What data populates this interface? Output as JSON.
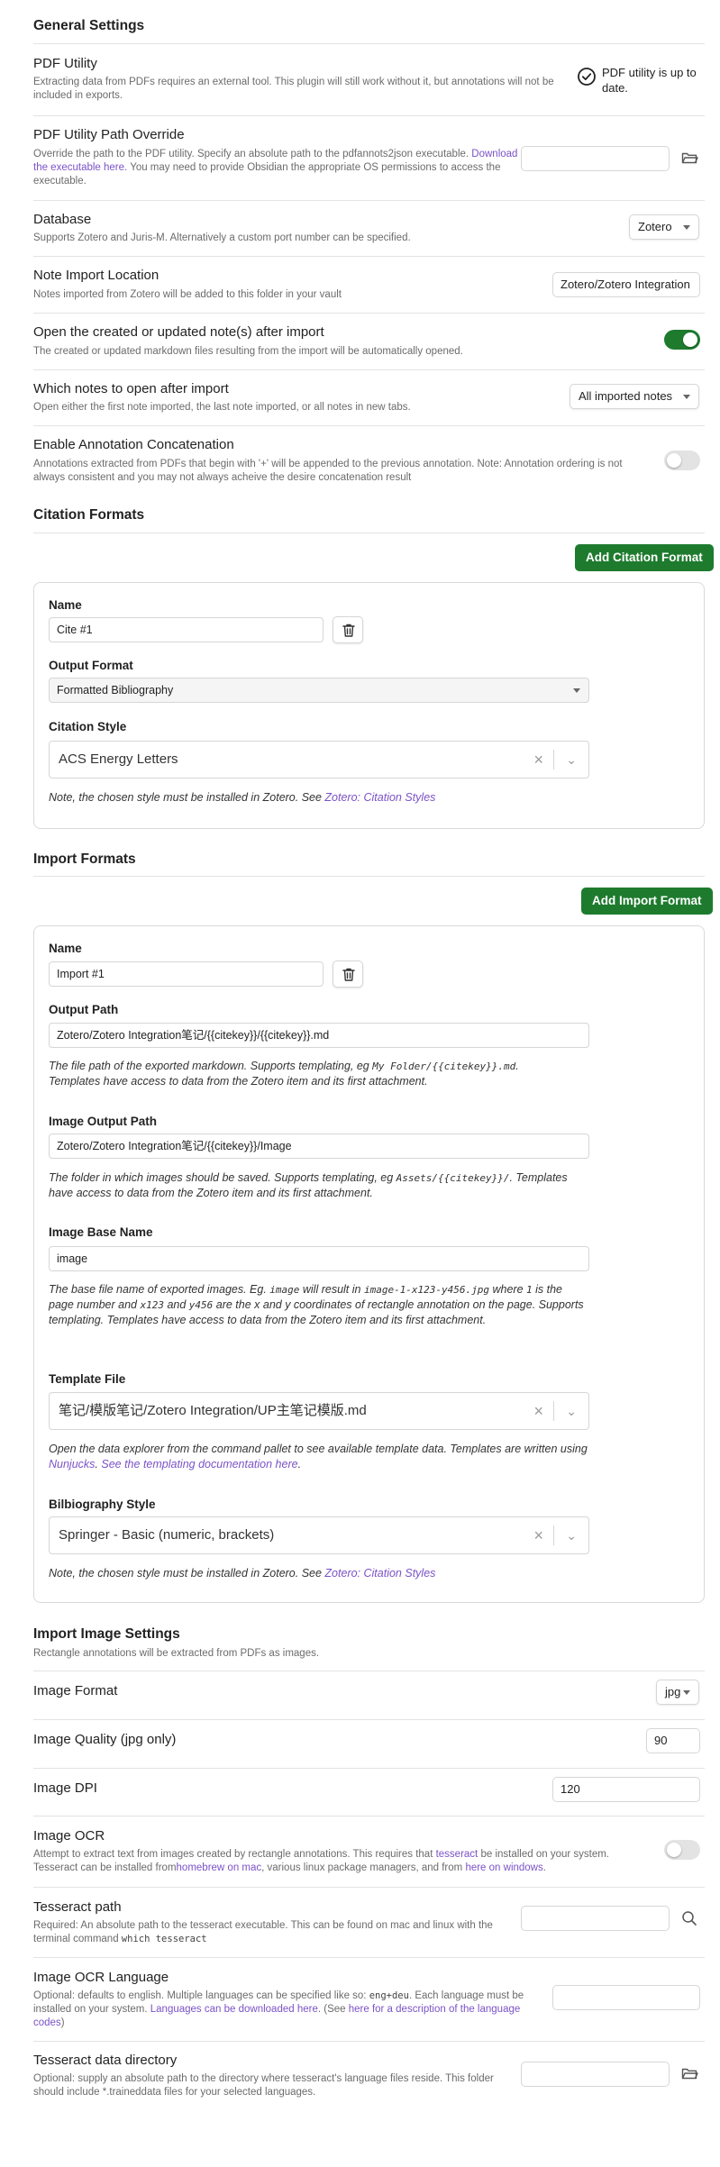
{
  "general": {
    "heading": "General Settings",
    "pdf_utility": {
      "name": "PDF Utility",
      "desc": "Extracting data from PDFs requires an external tool. This plugin will still work without it, but annotations will not be included in exports.",
      "status": "PDF utility is up to date."
    },
    "pdf_path": {
      "name": "PDF Utility Path Override",
      "desc_a": "Override the path to the PDF utility. Specify an absolute path to the pdfannots2json executable.",
      "desc_link": "Download the executable here.",
      "desc_b": " You may need to provide Obsidian the appropriate OS permissions to access the executable.",
      "value": ""
    },
    "database": {
      "name": "Database",
      "desc": "Supports Zotero and Juris-M. Alternatively a custom port number can be specified.",
      "value": "Zotero"
    },
    "note_location": {
      "name": "Note Import Location",
      "desc": "Notes imported from Zotero will be added to this folder in your vault",
      "value": "Zotero/Zotero Integration"
    },
    "open_after": {
      "name": "Open the created or updated note(s) after import",
      "desc": "The created or updated markdown files resulting from the import will be automatically opened.",
      "enabled": true
    },
    "which_notes": {
      "name": "Which notes to open after import",
      "desc": "Open either the first note imported, the last note imported, or all notes in new tabs.",
      "value": "All imported notes"
    },
    "concat": {
      "name": "Enable Annotation Concatenation",
      "desc": "Annotations extracted from PDFs that begin with '+' will be appended to the previous annotation. Note: Annotation ordering is not always consistent and you may not always acheive the desire concatenation result",
      "enabled": false
    }
  },
  "citation": {
    "heading": "Citation Formats",
    "add_label": "Add Citation Format",
    "name_label": "Name",
    "name_value": "Cite #1",
    "output_label": "Output Format",
    "output_value": "Formatted Bibliography",
    "style_label": "Citation Style",
    "style_value": "ACS Energy Letters",
    "note_a": "Note, the chosen style must be installed in Zotero. See ",
    "note_link": "Zotero: Citation Styles"
  },
  "import": {
    "heading": "Import Formats",
    "add_label": "Add Import Format",
    "name_label": "Name",
    "name_value": "Import #1",
    "output_path_label": "Output Path",
    "output_path_value": "Zotero/Zotero Integration笔记/{{citekey}}/{{citekey}}.md",
    "output_path_note_a": "The file path of the exported markdown. Supports templating, eg ",
    "output_path_note_code": "My Folder/{{citekey}}.md",
    "output_path_note_b": ". Templates have access to data from the Zotero item and its first attachment.",
    "image_output_label": "Image Output Path",
    "image_output_value": "Zotero/Zotero Integration笔记/{{citekey}}/Image",
    "image_output_note_a": "The folder in which images should be saved. Supports templating, eg ",
    "image_output_note_code": "Assets/{{citekey}}/",
    "image_output_note_b": ". Templates have access to data from the Zotero item and its first attachment.",
    "base_name_label": "Image Base Name",
    "base_name_value": "image",
    "base_name_note_1": "The base file name of exported images. Eg. ",
    "base_name_code_1": "image",
    "base_name_note_2": " will result in ",
    "base_name_code_2": "image-1-x123-y456.jpg",
    "base_name_note_3": " where ",
    "base_name_code_3": "1",
    "base_name_note_4": " is the page number and ",
    "base_name_code_4": "x123",
    "base_name_note_5": " and ",
    "base_name_code_5": "y456",
    "base_name_note_6": " are the x and y coordinates of rectangle annotation on the page. Supports templating. Templates have access to data from the Zotero item and its first attachment.",
    "template_label": "Template File",
    "template_value": "笔记/模版笔记/Zotero Integration/UP主笔记模版.md",
    "template_note_a": "Open the data explorer from the command pallet to see available template data. Templates are written using ",
    "template_link_1": "Nunjucks",
    "template_note_b": ". ",
    "template_link_2": "See the templating documentation here",
    "template_note_c": ".",
    "bib_label": "Bilbiography Style",
    "bib_value": "Springer - Basic (numeric, brackets)",
    "bib_note_a": "Note, the chosen style must be installed in Zotero. See ",
    "bib_note_link": "Zotero: Citation Styles"
  },
  "image_settings": {
    "heading": "Import Image Settings",
    "subheading": "Rectangle annotations will be extracted from PDFs as images.",
    "format": {
      "name": "Image Format",
      "value": "jpg"
    },
    "quality": {
      "name": "Image Quality (jpg only)",
      "value": "90"
    },
    "dpi": {
      "name": "Image DPI",
      "value": "120"
    },
    "ocr": {
      "name": "Image OCR",
      "desc_a": "Attempt to extract text from images created by rectangle annotations. This requires that ",
      "desc_link_1": "tesseract",
      "desc_b": " be installed on your system. Tesseract can be installed from",
      "desc_link_2": "homebrew on mac",
      "desc_c": ", various linux package managers, and from ",
      "desc_link_3": "here on windows",
      "desc_d": ".",
      "enabled": false
    },
    "tesseract_path": {
      "name": "Tesseract path",
      "desc_a": "Required: An absolute path to the tesseract executable. This can be found on mac and linux with the terminal command ",
      "desc_code": "which tesseract",
      "value": ""
    },
    "ocr_language": {
      "name": "Image OCR Language",
      "desc_a": "Optional: defaults to english. Multiple languages can be specified like so: ",
      "desc_code": "eng+deu",
      "desc_b": ". Each language must be installed on your system. ",
      "desc_link_1": "Languages can be downloaded here",
      "desc_c": ". (See ",
      "desc_link_2": "here for a description of the language codes",
      "desc_d": ")",
      "value": ""
    },
    "tesseract_data": {
      "name": "Tesseract data directory",
      "desc": "Optional: supply an absolute path to the directory where tesseract's language files reside. This folder should include *.traineddata files for your selected languages.",
      "value": ""
    }
  },
  "colors": {
    "accent": "#1e7b2e",
    "link": "#7b52c7",
    "border": "#d6d6d6"
  }
}
